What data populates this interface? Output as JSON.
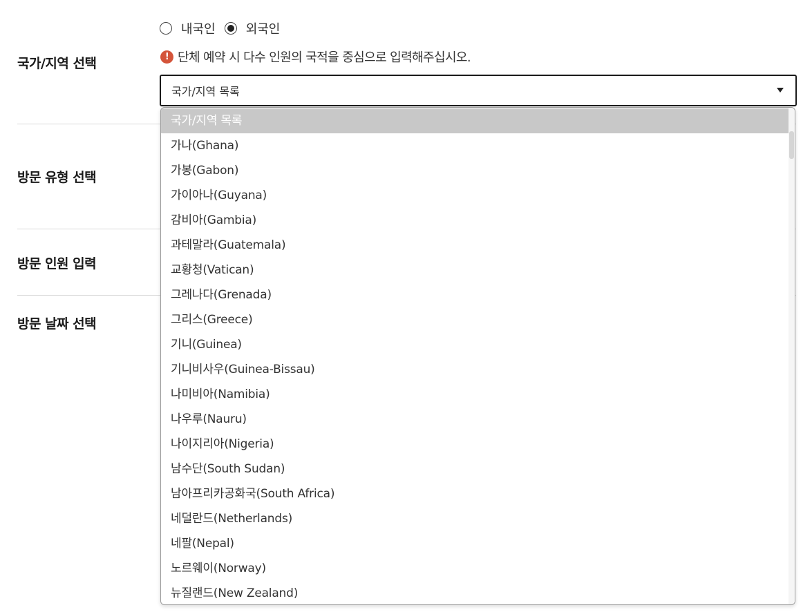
{
  "sections": {
    "country_label": "국가/지역 선택",
    "visit_type_label": "방문 유형 선택",
    "visitors_label": "방문 인원 입력",
    "date_label": "방문 날짜 선택"
  },
  "nationality": {
    "domestic_label": "내국인",
    "foreign_label": "외국인",
    "selected": "외국인"
  },
  "notice": {
    "icon": "!",
    "text": "단체 예약 시 다수 인원의 국적을 중심으로 입력해주십시오."
  },
  "country_select": {
    "value": "국가/지역 목록",
    "options": [
      "국가/지역 목록",
      "가나(Ghana)",
      "가봉(Gabon)",
      "가이아나(Guyana)",
      "감비아(Gambia)",
      "과테말라(Guatemala)",
      "교황청(Vatican)",
      "그레나다(Grenada)",
      "그리스(Greece)",
      "기니(Guinea)",
      "기니비사우(Guinea-Bissau)",
      "나미비아(Namibia)",
      "나우루(Nauru)",
      "나이지리아(Nigeria)",
      "남수단(South Sudan)",
      "남아프리카공화국(South Africa)",
      "네덜란드(Netherlands)",
      "네팔(Nepal)",
      "노르웨이(Norway)",
      "뉴질랜드(New Zealand)"
    ],
    "highlighted_index": 0
  },
  "colors": {
    "notice_icon": "#d4543a",
    "highlight_bg": "#c8c8c8",
    "divider": "#d9d9d9"
  }
}
